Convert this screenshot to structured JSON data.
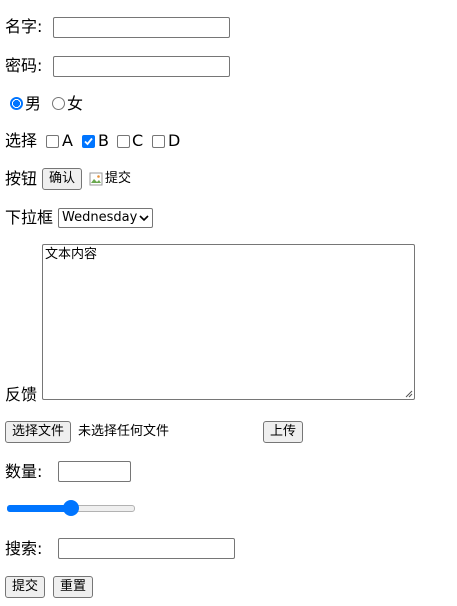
{
  "form": {
    "name_label": "名字:",
    "name_value": "",
    "password_label": "密码:",
    "password_value": "",
    "gender": {
      "male_label": "男",
      "female_label": "女",
      "selected": "男"
    },
    "choice": {
      "label": "选择",
      "options": [
        {
          "label": "A",
          "checked": false
        },
        {
          "label": "B",
          "checked": true
        },
        {
          "label": "C",
          "checked": false
        },
        {
          "label": "D",
          "checked": false
        }
      ]
    },
    "button_row": {
      "label": "按钮",
      "confirm_label": "确认",
      "image_alt": "提交"
    },
    "dropdown": {
      "label": "下拉框",
      "selected": "Wednesday"
    },
    "feedback": {
      "label": "反馈",
      "textarea_value": "文本内容"
    },
    "file": {
      "choose_label": "选择文件",
      "status": "未选择任何文件",
      "upload_label": "上传"
    },
    "quantity": {
      "label": "数量:",
      "value": ""
    },
    "range": {
      "value_fraction": 0.5
    },
    "search": {
      "label": "搜索:",
      "value": ""
    },
    "actions": {
      "submit_label": "提交",
      "reset_label": "重置"
    }
  },
  "colors": {
    "accent": "#0075ff",
    "border": "#767676",
    "button_bg": "#efefef"
  },
  "icons": {
    "broken_image": "broken-image-icon",
    "select_arrow": "chevron-down-icon",
    "resize_grip": "resize-grip-icon"
  }
}
